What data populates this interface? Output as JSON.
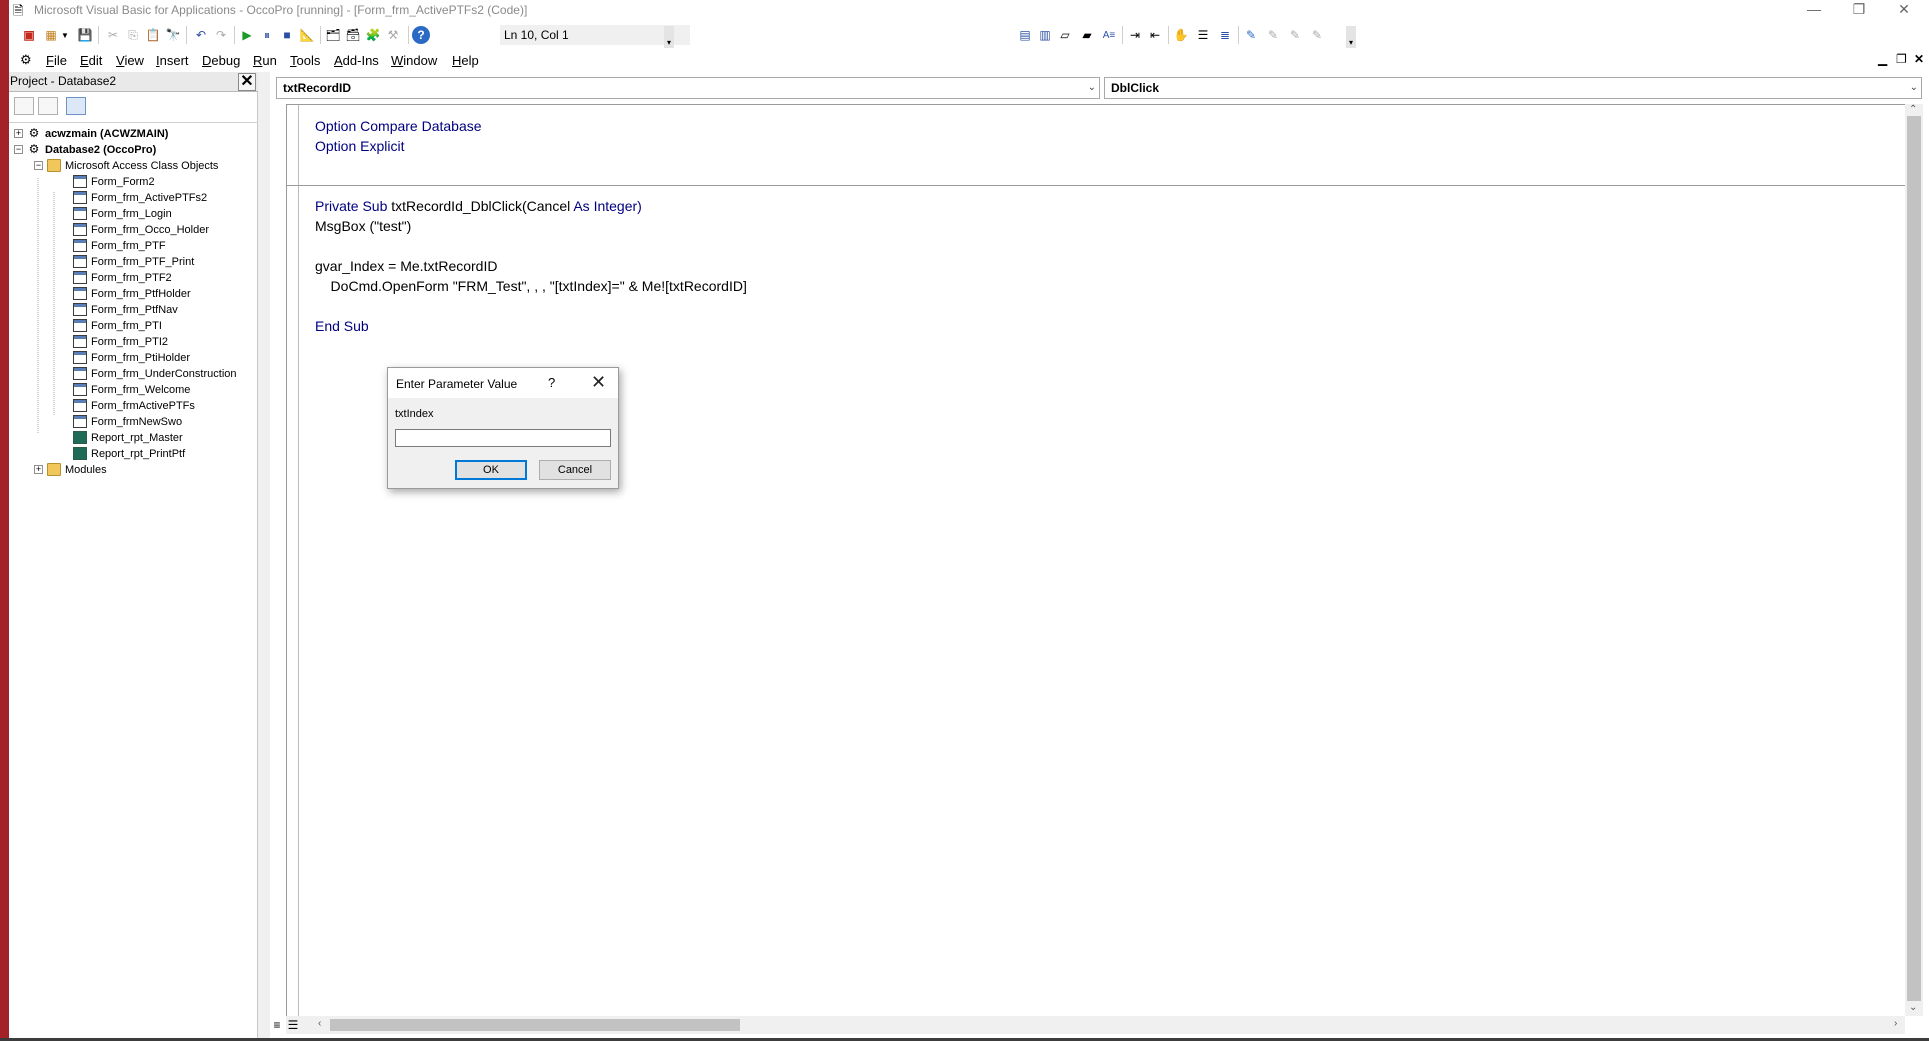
{
  "window": {
    "title": "Microsoft Visual Basic for Applications - OccoPro [running] - [Form_frm_ActivePTFs2 (Code)]",
    "controls": [
      "—",
      "❐",
      "✕"
    ],
    "accent_color": "#c42b1c"
  },
  "toolbar": {
    "position_readout": "Ln 10, Col 1"
  },
  "menubar": {
    "items": [
      {
        "label": "File",
        "accel": "F",
        "rest": "ile"
      },
      {
        "label": "Edit",
        "accel": "E",
        "rest": "dit"
      },
      {
        "label": "View",
        "accel": "V",
        "rest": "iew"
      },
      {
        "label": "Insert",
        "accel": "I",
        "rest": "nsert"
      },
      {
        "label": "Debug",
        "accel": "D",
        "rest": "ebug"
      },
      {
        "label": "Run",
        "accel": "R",
        "rest": "un"
      },
      {
        "label": "Tools",
        "accel": "T",
        "rest": "ools"
      },
      {
        "label": "Add-Ins",
        "accel": "A",
        "rest": "dd-Ins"
      },
      {
        "label": "Window",
        "accel": "W",
        "rest": "indow"
      },
      {
        "label": "Help",
        "accel": "H",
        "rest": "elp"
      }
    ]
  },
  "project": {
    "title": "Project - Database2",
    "nodes": [
      {
        "label": "acwzmain (ACWZMAIN)",
        "type": "project"
      },
      {
        "label": "Database2 (OccoPro)",
        "type": "project"
      },
      {
        "label": "Microsoft Access Class Objects",
        "type": "folder"
      },
      {
        "label": "Form_Form2",
        "type": "form"
      },
      {
        "label": "Form_frm_ActivePTFs2",
        "type": "form"
      },
      {
        "label": "Form_frm_Login",
        "type": "form"
      },
      {
        "label": "Form_frm_Occo_Holder",
        "type": "form"
      },
      {
        "label": "Form_frm_PTF",
        "type": "form"
      },
      {
        "label": "Form_frm_PTF_Print",
        "type": "form"
      },
      {
        "label": "Form_frm_PTF2",
        "type": "form"
      },
      {
        "label": "Form_frm_PtfHolder",
        "type": "form"
      },
      {
        "label": "Form_frm_PtfNav",
        "type": "form"
      },
      {
        "label": "Form_frm_PTI",
        "type": "form"
      },
      {
        "label": "Form_frm_PTI2",
        "type": "form"
      },
      {
        "label": "Form_frm_PtiHolder",
        "type": "form"
      },
      {
        "label": "Form_frm_UnderConstruction",
        "type": "form"
      },
      {
        "label": "Form_frm_Welcome",
        "type": "form"
      },
      {
        "label": "Form_frmActivePTFs",
        "type": "form"
      },
      {
        "label": "Form_frmNewSwo",
        "type": "form"
      },
      {
        "label": "Report_rpt_Master",
        "type": "report"
      },
      {
        "label": "Report_rpt_PrintPtf",
        "type": "report"
      },
      {
        "label": "Modules",
        "type": "folder"
      }
    ]
  },
  "code": {
    "object_combo": "txtRecordID",
    "procedure_combo": "DblClick",
    "keyword_color": "#00007f",
    "lines": {
      "l1": "Option Compare Database",
      "l2": "Option Explicit",
      "l4a": "Private Sub ",
      "l4b": "txtRecordId_DblClick(Cancel ",
      "l4c": "As Integer",
      "l4d": ")",
      "l5": "MsgBox (\"test\")",
      "l7": "gvar_Index = Me.txtRecordID",
      "l8": "    DoCmd.OpenForm \"FRM_Test\", , , \"[txtIndex]=\" & Me![txtRecordID]",
      "l10": "End Sub"
    }
  },
  "dialog": {
    "title": "Enter Parameter Value",
    "help": "?",
    "close": "✕",
    "label": "txtIndex",
    "value": "",
    "ok": "OK",
    "cancel": "Cancel"
  }
}
